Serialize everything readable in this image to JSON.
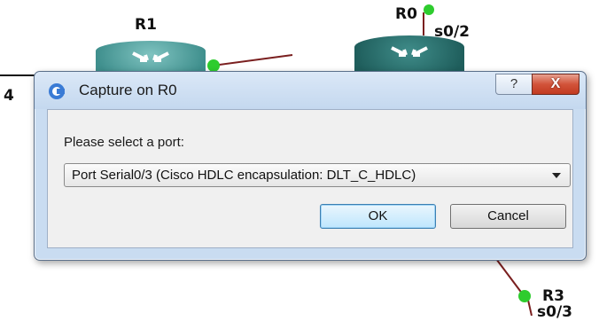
{
  "topology": {
    "labels": {
      "r1": "R1",
      "r0": "R0",
      "r0_port": "s0/2",
      "left_edge": "4",
      "r3": "R3",
      "r3_port": "s0/3"
    },
    "colors": {
      "router_r1": "#3f8f8d",
      "router_r0": "#1f5e5c",
      "link": "#7a1f1f",
      "link_dot": "#2ecc2e"
    }
  },
  "dialog": {
    "title": "Capture on R0",
    "help_label": "?",
    "close_label": "X",
    "prompt": "Please select a port:",
    "port_select": {
      "selected": "Port Serial0/3 (Cisco HDLC encapsulation: DLT_C_HDLC)"
    },
    "ok_label": "OK",
    "cancel_label": "Cancel"
  }
}
